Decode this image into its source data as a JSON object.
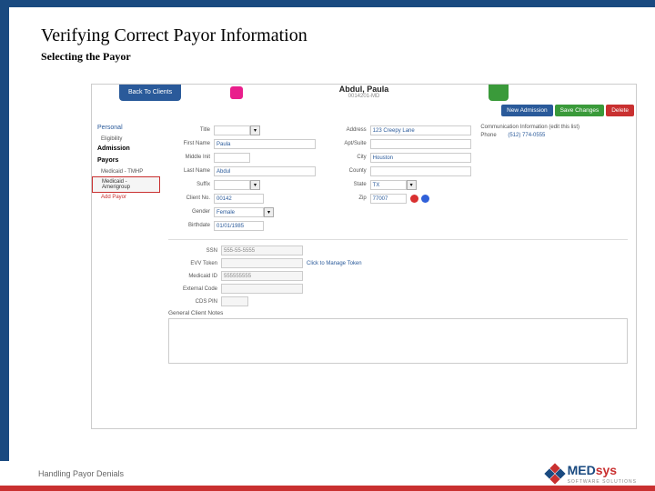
{
  "slide": {
    "title": "Verifying Correct Payor Information",
    "subtitle": "Selecting the Payor",
    "footer": "Handling Payor Denials"
  },
  "logo": {
    "brand1": "MED",
    "brand2": "sys",
    "tagline": "SOFTWARE SOLUTIONS"
  },
  "header": {
    "back": "Back To Clients",
    "patient_name": "Abdul, Paula",
    "patient_id": "0014201-MD"
  },
  "actions": {
    "new_admission": "New Admission",
    "save": "Save Changes",
    "delete": "Delete"
  },
  "sidebar": {
    "personal": "Personal",
    "eligibility": "Eligibility",
    "admission": "Admission",
    "payors": "Payors",
    "p1": "Medicaid - TMHP",
    "p2": "Medicaid - Amerigroup",
    "add": "Add Payor"
  },
  "labels": {
    "title": "Title",
    "first_name": "First Name",
    "middle_init": "Middle Init",
    "last_name": "Last Name",
    "suffix": "Suffix",
    "client_no": "Client No.",
    "gender": "Gender",
    "birthdate": "Birthdate",
    "address": "Address",
    "apt": "Apt/Suite",
    "city": "City",
    "county": "County",
    "state": "State",
    "zip": "Zip",
    "ssn": "SSN",
    "evv": "EVV Token",
    "medicaid": "Medicaid ID",
    "ext_code": "External Code",
    "cds": "CDS PIN",
    "notes": "General Client Notes",
    "comm_info": "Communication Information (edit this list)",
    "phone": "Phone",
    "token_link": "Click to Manage Token"
  },
  "values": {
    "first_name": "Paula",
    "last_name": "Abdul",
    "client_no": "00142",
    "gender": "Female",
    "birthdate": "01/01/1985",
    "address": "123 Creepy Lane",
    "city": "Houston",
    "state": "TX",
    "zip": "77007",
    "ssn": "555-55-5555",
    "medicaid": "555555555",
    "phone": "(512) 774-0555"
  }
}
